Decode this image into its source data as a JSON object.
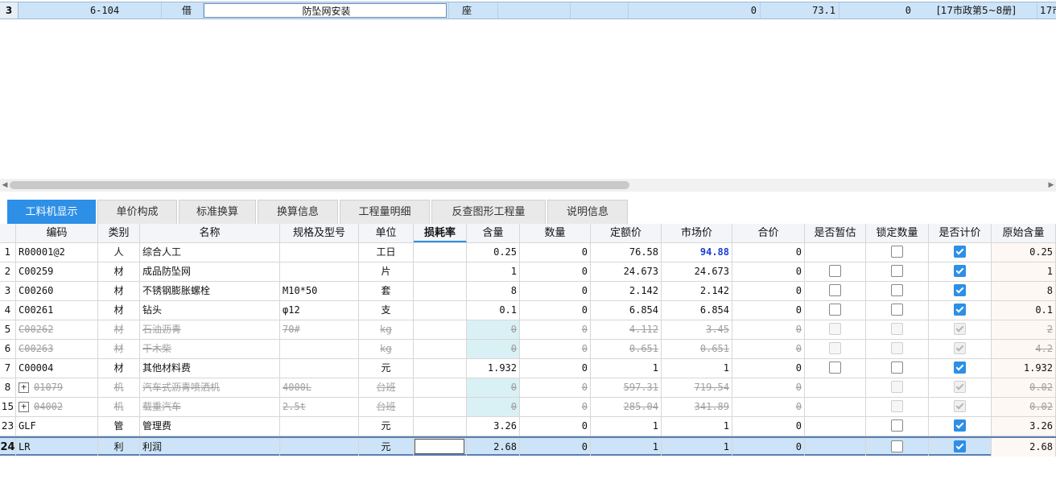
{
  "top_row": {
    "num": "3",
    "code": "6-104",
    "category": "借",
    "name": "防坠网安装",
    "unit": "座",
    "v1": "0",
    "v2": "73.1",
    "v3": "0",
    "source": "[17市政第5~8册]",
    "extra": "17市"
  },
  "tabs": [
    "工料机显示",
    "单价构成",
    "标准换算",
    "换算信息",
    "工程量明细",
    "反查图形工程量",
    "说明信息"
  ],
  "columns": [
    "",
    "编码",
    "类别",
    "名称",
    "规格及型号",
    "单位",
    "损耗率",
    "含量",
    "数量",
    "定额价",
    "市场价",
    "合价",
    "是否暂估",
    "锁定数量",
    "是否计价",
    "原始含量"
  ],
  "rows": [
    {
      "num": "1",
      "code": "R00001@2",
      "cat": "人",
      "name": "综合人工",
      "spec": "",
      "unit": "工日",
      "content": "0.25",
      "qty": "0",
      "quota": "76.58",
      "market": "94.88",
      "total": "0",
      "est": "none",
      "lock": "off",
      "priced": "on",
      "orig": "0.25",
      "state": "normal",
      "market_blue": true
    },
    {
      "num": "2",
      "code": "C00259",
      "cat": "材",
      "name": "成品防坠网",
      "spec": "",
      "unit": "片",
      "content": "1",
      "qty": "0",
      "quota": "24.673",
      "market": "24.673",
      "total": "0",
      "est": "off",
      "lock": "off",
      "priced": "on",
      "orig": "1",
      "state": "normal"
    },
    {
      "num": "3",
      "code": "C00260",
      "cat": "材",
      "name": "不锈钢膨胀螺栓",
      "spec": "M10*50",
      "unit": "套",
      "content": "8",
      "qty": "0",
      "quota": "2.142",
      "market": "2.142",
      "total": "0",
      "est": "off",
      "lock": "off",
      "priced": "on",
      "orig": "8",
      "state": "normal"
    },
    {
      "num": "4",
      "code": "C00261",
      "cat": "材",
      "name": "钻头",
      "spec": "φ12",
      "unit": "支",
      "content": "0.1",
      "qty": "0",
      "quota": "6.854",
      "market": "6.854",
      "total": "0",
      "est": "off",
      "lock": "off",
      "priced": "on",
      "orig": "0.1",
      "state": "normal"
    },
    {
      "num": "5",
      "code": "C00262",
      "cat": "材",
      "name": "石油沥青",
      "spec": "70#",
      "unit": "kg",
      "content": "0",
      "qty": "0",
      "quota": "4.112",
      "market": "3.45",
      "total": "0",
      "est": "off",
      "lock": "off",
      "priced": "on",
      "orig": "2",
      "state": "disabled"
    },
    {
      "num": "6",
      "code": "C00263",
      "cat": "材",
      "name": "干木柴",
      "spec": "",
      "unit": "kg",
      "content": "0",
      "qty": "0",
      "quota": "0.651",
      "market": "0.651",
      "total": "0",
      "est": "off",
      "lock": "off",
      "priced": "on",
      "orig": "4.2",
      "state": "disabled"
    },
    {
      "num": "7",
      "code": "C00004",
      "cat": "材",
      "name": "其他材料费",
      "spec": "",
      "unit": "元",
      "content": "1.932",
      "qty": "0",
      "quota": "1",
      "market": "1",
      "total": "0",
      "est": "off",
      "lock": "off",
      "priced": "on",
      "orig": "1.932",
      "state": "normal"
    },
    {
      "num": "8",
      "code": "01079",
      "cat": "机",
      "name": "汽车式沥青喷洒机",
      "spec": "4000L",
      "unit": "台班",
      "content": "0",
      "qty": "0",
      "quota": "597.31",
      "market": "719.54",
      "total": "0",
      "est": "none",
      "lock": "off",
      "priced": "on",
      "orig": "0.02",
      "state": "disabled",
      "expand": true
    },
    {
      "num": "15",
      "code": "04002",
      "cat": "机",
      "name": "载重汽车",
      "spec": "2.5t",
      "unit": "台班",
      "content": "0",
      "qty": "0",
      "quota": "285.04",
      "market": "341.89",
      "total": "0",
      "est": "none",
      "lock": "off",
      "priced": "on",
      "orig": "0.02",
      "state": "disabled",
      "expand": true
    },
    {
      "num": "23",
      "code": "GLF",
      "cat": "管",
      "name": "管理费",
      "spec": "",
      "unit": "元",
      "content": "3.26",
      "qty": "0",
      "quota": "1",
      "market": "1",
      "total": "0",
      "est": "none",
      "lock": "off",
      "priced": "on",
      "orig": "3.26",
      "state": "normal"
    },
    {
      "num": "24",
      "code": "LR",
      "cat": "利",
      "name": "利润",
      "spec": "",
      "unit": "元",
      "content": "2.68",
      "qty": "0",
      "quota": "1",
      "market": "1",
      "total": "0",
      "est": "none",
      "lock": "off",
      "priced": "on",
      "orig": "2.68",
      "state": "selected"
    }
  ],
  "colors": {
    "accent": "#2d8fe6",
    "selected_row": "#cde3f7",
    "blue_value": "#1a3ed6",
    "shade": "#d9f1f5"
  }
}
